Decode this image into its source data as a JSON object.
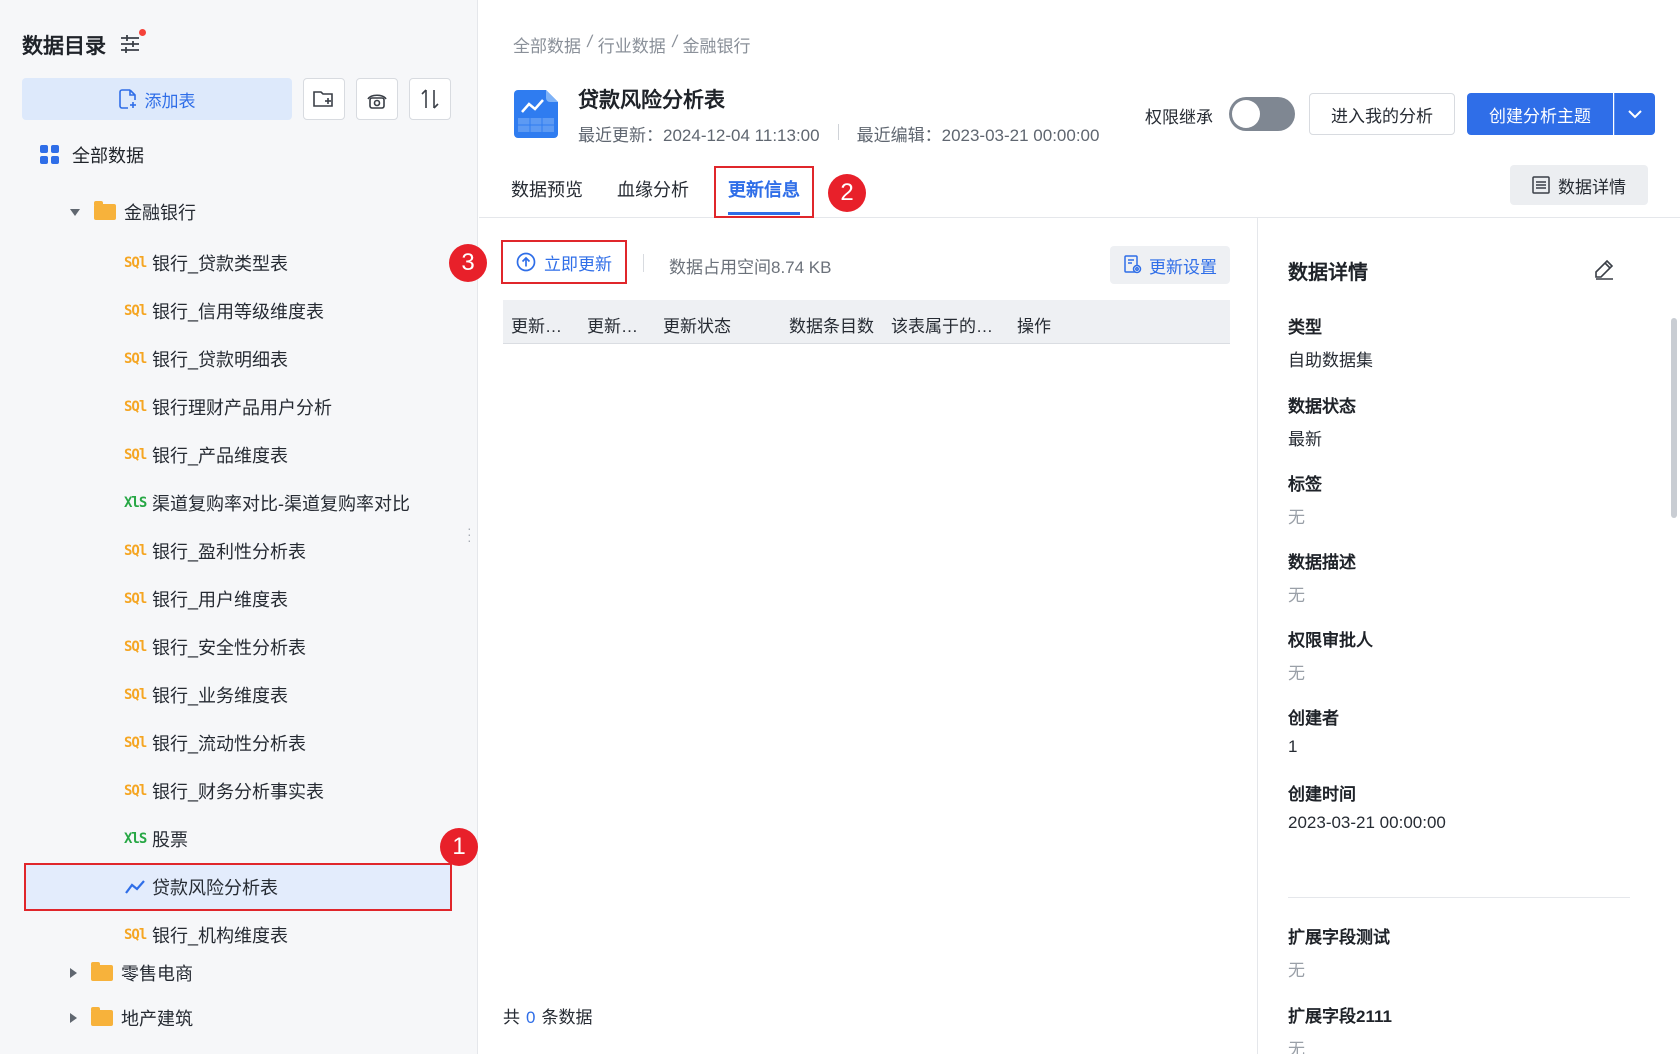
{
  "sidebar": {
    "title": "数据目录",
    "add_table_label": "添加表",
    "root_label": "全部数据",
    "folder_open": "金融银行",
    "items": [
      {
        "type": "sql",
        "icon_text": "SQl",
        "label": "银行_贷款类型表"
      },
      {
        "type": "sql",
        "icon_text": "SQl",
        "label": "银行_信用等级维度表"
      },
      {
        "type": "sql",
        "icon_text": "SQl",
        "label": "银行_贷款明细表"
      },
      {
        "type": "sql",
        "icon_text": "SQl",
        "label": "银行理财产品用户分析"
      },
      {
        "type": "sql",
        "icon_text": "SQl",
        "label": "银行_产品维度表"
      },
      {
        "type": "xls",
        "icon_text": "XlS",
        "label": "渠道复购率对比-渠道复购率对比"
      },
      {
        "type": "sql",
        "icon_text": "SQl",
        "label": "银行_盈利性分析表"
      },
      {
        "type": "sql",
        "icon_text": "SQl",
        "label": "银行_用户维度表"
      },
      {
        "type": "sql",
        "icon_text": "SQl",
        "label": "银行_安全性分析表"
      },
      {
        "type": "sql",
        "icon_text": "SQl",
        "label": "银行_业务维度表"
      },
      {
        "type": "sql",
        "icon_text": "SQl",
        "label": "银行_流动性分析表"
      },
      {
        "type": "sql",
        "icon_text": "SQl",
        "label": "银行_财务分析事实表"
      },
      {
        "type": "xls",
        "icon_text": "XlS",
        "label": "股票"
      },
      {
        "type": "analysis",
        "icon_text": "",
        "label": "贷款风险分析表"
      },
      {
        "type": "sql",
        "icon_text": "SQl",
        "label": "银行_机构维度表"
      }
    ],
    "folder_closed_1": "零售电商",
    "folder_closed_2": "地产建筑"
  },
  "badges": {
    "one": "1",
    "two": "2",
    "three": "3"
  },
  "header": {
    "breadcrumb": [
      "全部数据",
      "行业数据",
      "金融银行"
    ],
    "title": "贷款风险分析表",
    "last_update": "最近更新：2024-12-04 11:13:00",
    "last_edit": "最近编辑：2023-03-21 00:00:00",
    "perm_inherit_label": "权限继承",
    "perm_inherit_on": false,
    "enter_analysis_label": "进入我的分析",
    "create_topic_label": "创建分析主题"
  },
  "tabs": [
    "数据预览",
    "血缘分析",
    "更新信息"
  ],
  "active_tab": "更新信息",
  "data_detail_button": "数据详情",
  "update": {
    "update_now_label": "立即更新",
    "space_text": "数据占用空间8.74 KB",
    "settings_label": "更新设置",
    "columns": [
      "更新…",
      "更新…",
      "更新状态",
      "数据条目数",
      "该表属于的…",
      "操作"
    ],
    "footer_prefix": "共",
    "footer_count": "0",
    "footer_suffix": "条数据"
  },
  "panel": {
    "title": "数据详情",
    "fields": [
      {
        "label": "类型",
        "value": "自助数据集"
      },
      {
        "label": "数据状态",
        "value": "最新"
      },
      {
        "label": "标签",
        "value": "无"
      },
      {
        "label": "数据描述",
        "value": "无"
      },
      {
        "label": "权限审批人",
        "value": "无"
      },
      {
        "label": "创建者",
        "value": "1"
      },
      {
        "label": "创建时间",
        "value": "2023-03-21 00:00:00"
      }
    ],
    "ext_fields": [
      {
        "label": "扩展字段测试",
        "value": "无"
      },
      {
        "label": "扩展字段2111",
        "value": "无"
      }
    ]
  },
  "colors": {
    "accent": "#2f6ee8",
    "highlight_red": "#e0262b",
    "sql_icon": "#f5a623",
    "xls_icon": "#27a745",
    "folder": "#f7b23b"
  }
}
